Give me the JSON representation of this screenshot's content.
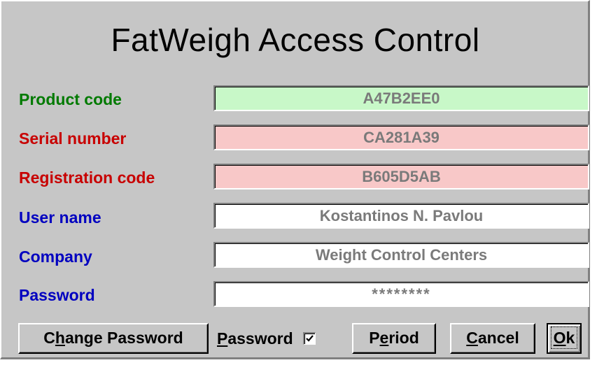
{
  "dialog": {
    "title": "FatWeigh Access Control"
  },
  "fields": {
    "product_code": {
      "label": "Product code",
      "value": "A47B2EE0",
      "label_color": "#007a00",
      "bg_color": "#c8f8c8"
    },
    "serial_number": {
      "label": "Serial number",
      "value": "CA281A39",
      "label_color": "#c80000",
      "bg_color": "#f8c8c8"
    },
    "registration_code": {
      "label": "Registration code",
      "value": "B605D5AB",
      "label_color": "#c80000",
      "bg_color": "#f8c8c8"
    },
    "user_name": {
      "label": "User name",
      "value": "Kostantinos N. Pavlou",
      "label_color": "#0000c0",
      "bg_color": "#ffffff"
    },
    "company": {
      "label": "Company",
      "value": "Weight Control Centers",
      "label_color": "#0000c0",
      "bg_color": "#ffffff"
    },
    "password": {
      "label": "Password",
      "value": "********",
      "label_color": "#0000c0",
      "bg_color": "#ffffff"
    }
  },
  "buttons": {
    "change_password": {
      "pre": "C",
      "accel": "h",
      "post": "ange Password"
    },
    "period": {
      "pre": "P",
      "accel": "e",
      "post": "riod"
    },
    "cancel": {
      "pre": "",
      "accel": "C",
      "post": "ancel"
    },
    "ok": {
      "pre": "",
      "accel": "O",
      "post": "k"
    }
  },
  "password_checkbox": {
    "accel": "P",
    "rest": "assword",
    "checked": true
  }
}
